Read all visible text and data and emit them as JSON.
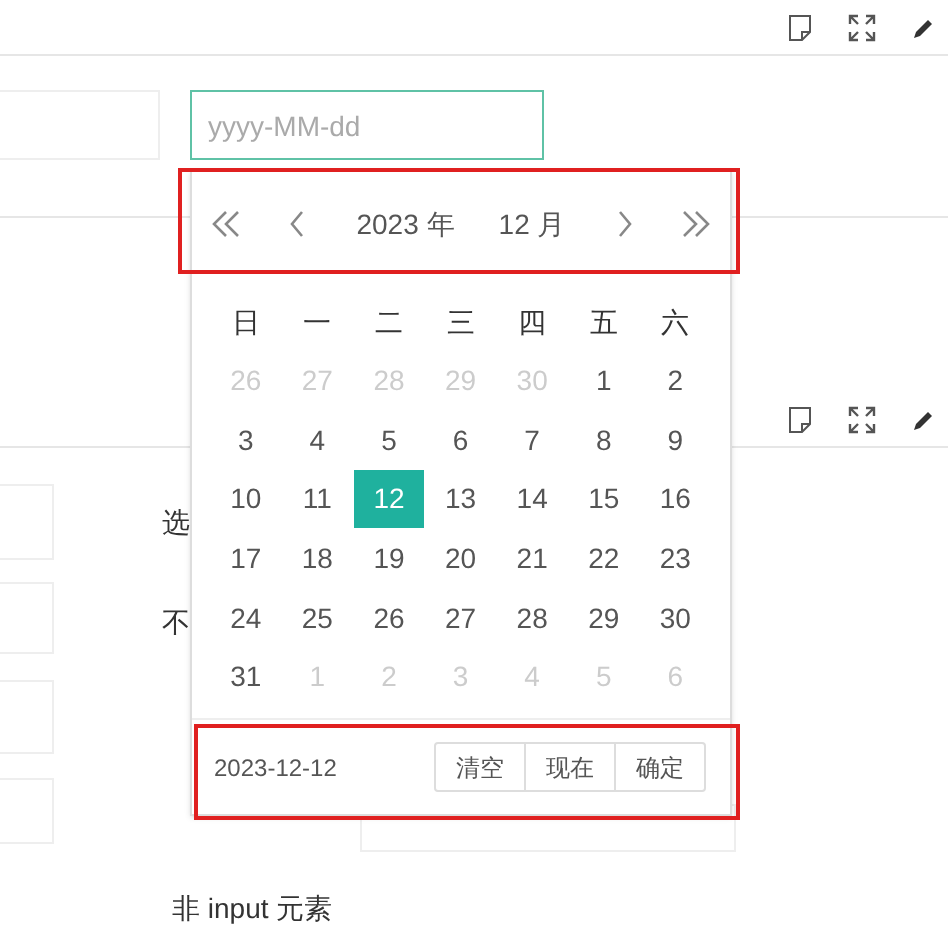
{
  "date_input": {
    "placeholder": "yyyy-MM-dd",
    "focused": true
  },
  "form_labels": [
    {
      "text": "选"
    },
    {
      "text": "不"
    }
  ],
  "section_label": "非 input 元素",
  "calendar": {
    "header": {
      "year": "2023 年",
      "month": "12 月",
      "highlighted": true
    },
    "weekdays": [
      "日",
      "一",
      "二",
      "三",
      "四",
      "五",
      "六"
    ],
    "days": [
      {
        "label": "26",
        "muted": true,
        "selected": false
      },
      {
        "label": "27",
        "muted": true,
        "selected": false
      },
      {
        "label": "28",
        "muted": true,
        "selected": false
      },
      {
        "label": "29",
        "muted": true,
        "selected": false
      },
      {
        "label": "30",
        "muted": true,
        "selected": false
      },
      {
        "label": "1",
        "muted": false,
        "selected": false
      },
      {
        "label": "2",
        "muted": false,
        "selected": false
      },
      {
        "label": "3",
        "muted": false,
        "selected": false
      },
      {
        "label": "4",
        "muted": false,
        "selected": false
      },
      {
        "label": "5",
        "muted": false,
        "selected": false
      },
      {
        "label": "6",
        "muted": false,
        "selected": false
      },
      {
        "label": "7",
        "muted": false,
        "selected": false
      },
      {
        "label": "8",
        "muted": false,
        "selected": false
      },
      {
        "label": "9",
        "muted": false,
        "selected": false
      },
      {
        "label": "10",
        "muted": false,
        "selected": false
      },
      {
        "label": "11",
        "muted": false,
        "selected": false
      },
      {
        "label": "12",
        "muted": false,
        "selected": true
      },
      {
        "label": "13",
        "muted": false,
        "selected": false
      },
      {
        "label": "14",
        "muted": false,
        "selected": false
      },
      {
        "label": "15",
        "muted": false,
        "selected": false
      },
      {
        "label": "16",
        "muted": false,
        "selected": false
      },
      {
        "label": "17",
        "muted": false,
        "selected": false
      },
      {
        "label": "18",
        "muted": false,
        "selected": false
      },
      {
        "label": "19",
        "muted": false,
        "selected": false
      },
      {
        "label": "20",
        "muted": false,
        "selected": false
      },
      {
        "label": "21",
        "muted": false,
        "selected": false
      },
      {
        "label": "22",
        "muted": false,
        "selected": false
      },
      {
        "label": "23",
        "muted": false,
        "selected": false
      },
      {
        "label": "24",
        "muted": false,
        "selected": false
      },
      {
        "label": "25",
        "muted": false,
        "selected": false
      },
      {
        "label": "26",
        "muted": false,
        "selected": false
      },
      {
        "label": "27",
        "muted": false,
        "selected": false
      },
      {
        "label": "28",
        "muted": false,
        "selected": false
      },
      {
        "label": "29",
        "muted": false,
        "selected": false
      },
      {
        "label": "30",
        "muted": false,
        "selected": false
      },
      {
        "label": "31",
        "muted": false,
        "selected": false
      },
      {
        "label": "1",
        "muted": true,
        "selected": false
      },
      {
        "label": "2",
        "muted": true,
        "selected": false
      },
      {
        "label": "3",
        "muted": true,
        "selected": false
      },
      {
        "label": "4",
        "muted": true,
        "selected": false
      },
      {
        "label": "5",
        "muted": true,
        "selected": false
      },
      {
        "label": "6",
        "muted": true,
        "selected": false
      }
    ],
    "footer": {
      "value": "2023-12-12",
      "buttons": [
        "清空",
        "现在",
        "确定"
      ],
      "highlighted": true
    }
  }
}
